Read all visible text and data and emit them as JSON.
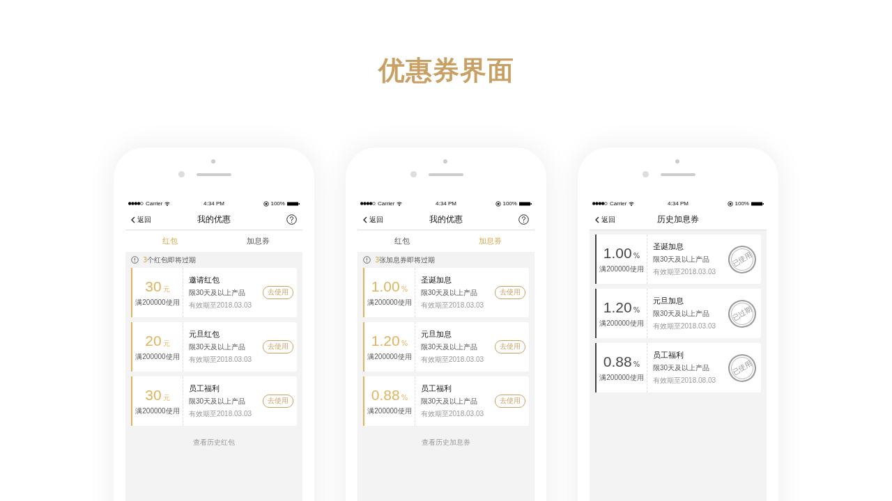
{
  "title": "优惠券界面",
  "phones": [
    {
      "status": {
        "carrier": "Carrier",
        "time": "4:34 PM",
        "battery": "100%"
      },
      "nav": {
        "back": "返回",
        "title": "我的优惠",
        "help": true
      },
      "tabs": [
        {
          "label": "红包",
          "selected": true
        },
        {
          "label": "加息券",
          "selected": false
        }
      ],
      "notice": {
        "count": "3",
        "text": "个红包即将过期"
      },
      "coupons": [
        {
          "amount": "30",
          "unit": "元",
          "condition": "满200000使用",
          "name": "邀请红包",
          "term": "限30天及以上产品",
          "expiry": "有效期至2018.03.03",
          "action": "去使用"
        },
        {
          "amount": "20",
          "unit": "元",
          "condition": "满200000使用",
          "name": "元旦红包",
          "term": "限30天及以上产品",
          "expiry": "有效期至2018.03.03",
          "action": "去使用"
        },
        {
          "amount": "30",
          "unit": "元",
          "condition": "满200000使用",
          "name": "员工福利",
          "term": "限30天及以上产品",
          "expiry": "有效期至2018.03.03",
          "action": "去使用"
        }
      ],
      "footer": "查看历史红包"
    },
    {
      "status": {
        "carrier": "Carrier",
        "time": "4:34 PM",
        "battery": "100%"
      },
      "nav": {
        "back": "返回",
        "title": "我的优惠",
        "help": true
      },
      "tabs": [
        {
          "label": "红包",
          "selected": false
        },
        {
          "label": "加息券",
          "selected": true
        }
      ],
      "notice": {
        "count": "3",
        "text": "张加息券即将过期"
      },
      "coupons": [
        {
          "amount": "1.00",
          "unit": "%",
          "condition": "满200000使用",
          "name": "圣诞加息",
          "term": "限30天及以上产品",
          "expiry": "有效期至2018.03.03",
          "action": "去使用"
        },
        {
          "amount": "1.20",
          "unit": "%",
          "condition": "满200000使用",
          "name": "元旦加息",
          "term": "限30天及以上产品",
          "expiry": "有效期至2018.03.03",
          "action": "去使用"
        },
        {
          "amount": "0.88",
          "unit": "%",
          "condition": "满200000使用",
          "name": "员工福利",
          "term": "限30天及以上产品",
          "expiry": "有效期至2018.03.03",
          "action": "去使用"
        }
      ],
      "footer": "查看历史加息券"
    },
    {
      "status": {
        "carrier": "Carrier",
        "time": "4:34 PM",
        "battery": "100%"
      },
      "nav": {
        "back": "返回",
        "title": "历史加息券",
        "help": false
      },
      "coupons": [
        {
          "amount": "1.00",
          "unit": "%",
          "condition": "满200000使用",
          "name": "圣诞加息",
          "term": "限30天及以上产品",
          "expiry": "有效期至2018.03.03",
          "stamp": "已使用"
        },
        {
          "amount": "1.20",
          "unit": "%",
          "condition": "满200000使用",
          "name": "元旦加息",
          "term": "限30天及以上产品",
          "expiry": "有效期至2018.03.03",
          "stamp": "已过期"
        },
        {
          "amount": "0.88",
          "unit": "%",
          "condition": "满200000使用",
          "name": "员工福利",
          "term": "限30天及以上产品",
          "expiry": "有效期至2018.08.03",
          "stamp": "已使用"
        }
      ]
    }
  ]
}
